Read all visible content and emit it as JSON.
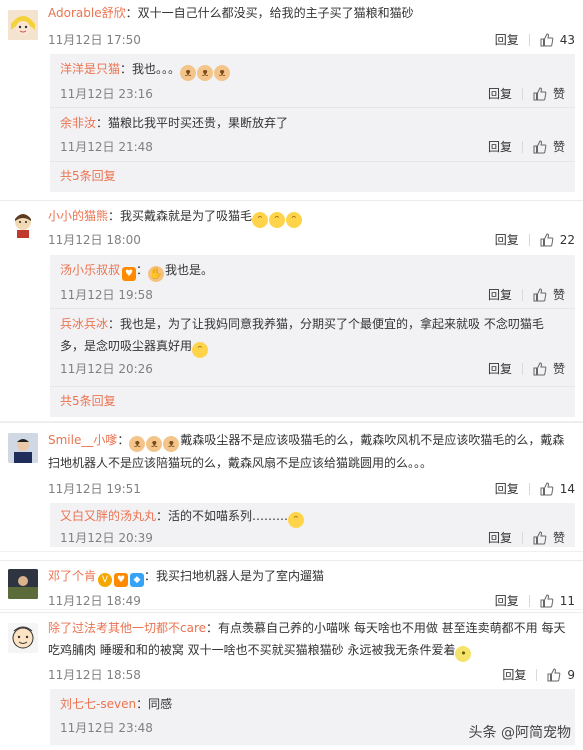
{
  "reply_label": "回复",
  "like_label": "赞",
  "comments": [
    {
      "user": "Adorable舒欣",
      "text": "：双十一自己什么都没买，给我的主子买了猫粮和猫砂",
      "time": "11月12日 17:50",
      "likes": "43",
      "replies": [
        {
          "user": "洋洋是只猫",
          "text": "：我也。。。",
          "time": "11月12日 23:16"
        },
        {
          "user": "余非汝",
          "text": "：猫粮比我平时买还贵，果断放弃了",
          "time": "11月12日 21:48"
        }
      ],
      "more": "共5条回复"
    },
    {
      "user": "小小的猫熊",
      "text": "：我买戴森就是为了吸猫毛",
      "time": "11月12日 18:00",
      "likes": "22",
      "replies": [
        {
          "user": "汤小乐叔叔",
          "text": "我也是。",
          "time": "11月12日 19:58"
        },
        {
          "user": "兵冰兵冰",
          "text": "：我也是，为了让我妈同意我养猫，分期买了个最便宜的，拿起来就吸 不念叨猫毛",
          "text2": "多，是念叨吸尘器真好用",
          "time": "11月12日 20:26"
        }
      ],
      "more": "共5条回复"
    },
    {
      "user": "Smile__小嗲",
      "text": "戴森吸尘器不是应该吸猫毛的么，戴森吹风机不是应该吹猫毛的么，戴森",
      "text2": "扫地机器人不是应该陪猫玩的么，戴森风扇不是应该给猫跳圆用的么。。。",
      "time": "11月12日 19:51",
      "likes": "14",
      "replies": [
        {
          "user": "又白又胖的汤丸丸",
          "text": "：活的不如喵系列………",
          "time": "11月12日 20:39"
        }
      ]
    },
    {
      "user": "邓了个肯",
      "text": "：我买扫地机器人是为了室内遛猫",
      "time": "11月12日 18:49",
      "likes": "11"
    },
    {
      "user": "除了过法考其他一切都不care",
      "text": "：有点羡慕自己养的小喵咪 每天啥也不用做 甚至连卖萌都不用 每天",
      "text2": "吃鸡脯肉 睡暖和和的被窝  双十一啥也不买就买猫粮猫砂 永远被我无条件爱着",
      "time": "11月12日 18:58",
      "likes": "9",
      "replies": [
        {
          "user": "刘七七-seven",
          "text": "：同感",
          "time": "11月12日 23:48"
        }
      ]
    }
  ],
  "watermark": "头条 @阿简宠物"
}
